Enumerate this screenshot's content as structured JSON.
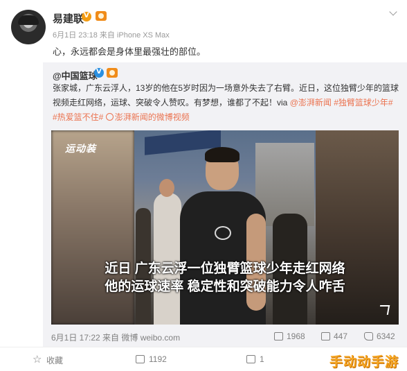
{
  "post": {
    "username": "易建联",
    "meta": "6月1日 23:18 来自 iPhone XS Max",
    "text": "心，永远都会是身体里最强壮的部位。"
  },
  "repost": {
    "username": "@中国篮球",
    "line1_text": "张家城，广东云浮人，13岁的他在5岁时因为一场意外失去了右臂。近日，这位独臂少年的篮球",
    "line2_text": "视频走红网络，运球、突破令人赞叹。有梦想，谁都了不起！via ",
    "line2_link1": "@澎湃新闻",
    "line2_link2": " #独臂篮球少年#",
    "line3_tag": "#热爱篮不住#",
    "line3_link": "澎湃新闻的微博视频",
    "video": {
      "logo": "运动装",
      "caption_line1": "近日 广东云浮一位独臂篮球少年走红网络",
      "caption_line2": "他的运球速率 稳定性和突破能力令人咋舌"
    },
    "footer": {
      "meta": "6月1日 17:22 来自 微博 weibo.com",
      "reposts": "1968",
      "comments": "447",
      "likes": "6342"
    }
  },
  "actions": {
    "favorite": "收藏",
    "repost": "1192",
    "comment": "1"
  },
  "watermark": "手动动手游"
}
